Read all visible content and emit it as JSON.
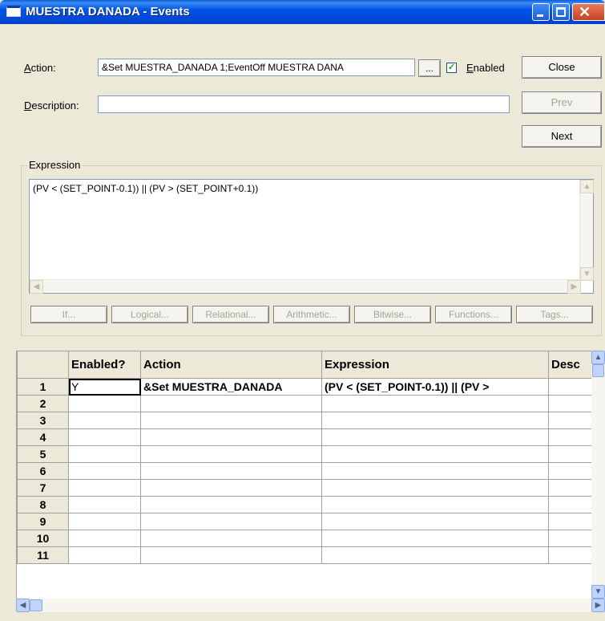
{
  "window": {
    "title": "MUESTRA DANADA - Events"
  },
  "action": {
    "label": "Action:",
    "value": "&Set MUESTRA_DANADA 1;EventOff MUESTRA DANA",
    "browse_label": "...",
    "enabled_label": "Enabled",
    "enabled_checked": true
  },
  "description": {
    "label": "Description:",
    "value": ""
  },
  "buttons": {
    "close": "Close",
    "prev": "Prev",
    "next": "Next"
  },
  "expression": {
    "group_label": "Expression",
    "text": "(PV < (SET_POINT-0.1)) || (PV > (SET_POINT+0.1))",
    "tool_buttons": [
      "If...",
      "Logical...",
      "Relational...",
      "Arithmetic...",
      "Bitwise...",
      "Functions...",
      "Tags..."
    ]
  },
  "grid": {
    "columns": [
      "Enabled?",
      "Action",
      "Expression",
      "Desc"
    ],
    "rows": [
      {
        "num": "1",
        "enabled": "Y",
        "action": "&Set MUESTRA_DANADA",
        "expression": "(PV < (SET_POINT-0.1)) || (PV >",
        "desc": ""
      },
      {
        "num": "2",
        "enabled": "",
        "action": "",
        "expression": "",
        "desc": ""
      },
      {
        "num": "3",
        "enabled": "",
        "action": "",
        "expression": "",
        "desc": ""
      },
      {
        "num": "4",
        "enabled": "",
        "action": "",
        "expression": "",
        "desc": ""
      },
      {
        "num": "5",
        "enabled": "",
        "action": "",
        "expression": "",
        "desc": ""
      },
      {
        "num": "6",
        "enabled": "",
        "action": "",
        "expression": "",
        "desc": ""
      },
      {
        "num": "7",
        "enabled": "",
        "action": "",
        "expression": "",
        "desc": ""
      },
      {
        "num": "8",
        "enabled": "",
        "action": "",
        "expression": "",
        "desc": ""
      },
      {
        "num": "9",
        "enabled": "",
        "action": "",
        "expression": "",
        "desc": ""
      },
      {
        "num": "10",
        "enabled": "",
        "action": "",
        "expression": "",
        "desc": ""
      },
      {
        "num": "11",
        "enabled": "",
        "action": "",
        "expression": "",
        "desc": ""
      }
    ]
  },
  "colors": {
    "titlebar": "#0055E5",
    "dialog_bg": "#ECE9D8",
    "close_button": "#C8411E"
  }
}
